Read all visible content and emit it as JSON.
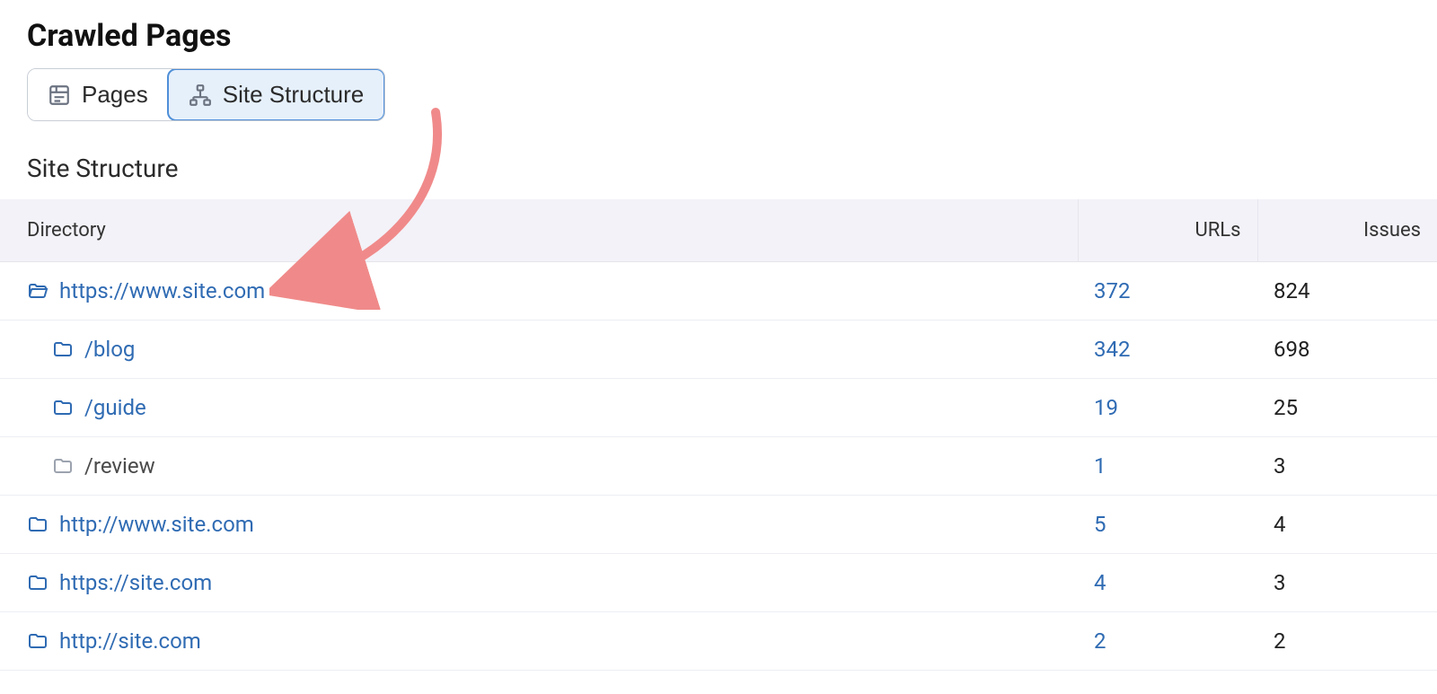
{
  "header": {
    "title": "Crawled Pages"
  },
  "tabs": {
    "pages": {
      "label": "Pages"
    },
    "site_structure": {
      "label": "Site Structure"
    }
  },
  "subheading": "Site Structure",
  "columns": {
    "directory": "Directory",
    "urls": "URLs",
    "issues": "Issues"
  },
  "rows": [
    {
      "label": "https://www.site.com",
      "urls": "372",
      "issues": "824",
      "indent": 0,
      "open": true,
      "muted": false
    },
    {
      "label": "/blog",
      "urls": "342",
      "issues": "698",
      "indent": 1,
      "open": false,
      "muted": false
    },
    {
      "label": "/guide",
      "urls": "19",
      "issues": "25",
      "indent": 1,
      "open": false,
      "muted": false
    },
    {
      "label": "/review",
      "urls": "1",
      "issues": "3",
      "indent": 1,
      "open": false,
      "muted": true
    },
    {
      "label": "http://www.site.com",
      "urls": "5",
      "issues": "4",
      "indent": 0,
      "open": false,
      "muted": false
    },
    {
      "label": "https://site.com",
      "urls": "4",
      "issues": "3",
      "indent": 0,
      "open": false,
      "muted": false
    },
    {
      "label": "http://site.com",
      "urls": "2",
      "issues": "2",
      "indent": 0,
      "open": false,
      "muted": false
    }
  ]
}
